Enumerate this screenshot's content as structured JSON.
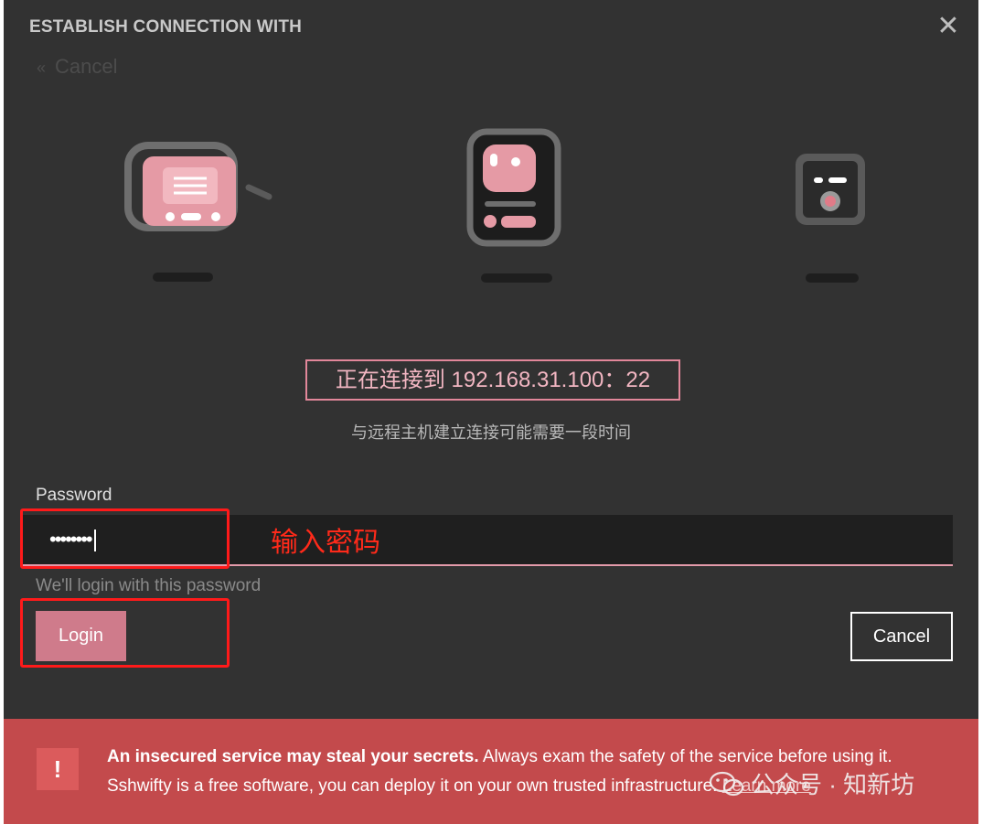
{
  "dialog": {
    "title": "ESTABLISH CONNECTION WITH",
    "back_label": "Cancel",
    "back_glyph": "«"
  },
  "status": {
    "connecting": "正在连接到 192.168.31.100：22",
    "subtitle": "与远程主机建立连接可能需要一段时间"
  },
  "password": {
    "label": "Password",
    "value": "••••••••",
    "hint": "We'll login with this password"
  },
  "annotation": {
    "text": "输入密码"
  },
  "buttons": {
    "login": "Login",
    "cancel": "Cancel"
  },
  "warning": {
    "icon": "!",
    "bold": "An insecured service may steal your secrets.",
    "line1_rest": " Always exam the safety of the service before using it.",
    "line2": "Sshwifty is a free software, you can deploy it on your own trusted infrastructure. ",
    "learn_more": "Learn more"
  },
  "watermark": {
    "text": "公众号 · 知新坊"
  },
  "icons": {
    "left": "radio-icon",
    "middle": "robot-icon",
    "right": "device-icon",
    "close": "close-icon"
  },
  "colors": {
    "background": "#323232",
    "accent_pink": "#e39aaa",
    "warning_red": "#c34a4c",
    "annotation_red": "#ff1a1a"
  }
}
